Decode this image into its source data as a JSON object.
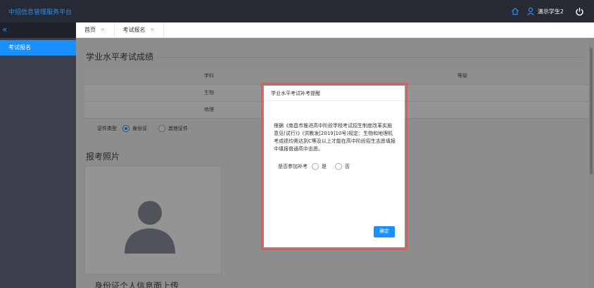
{
  "app": {
    "title": "中招信息管理服务平台",
    "user": "演示学生2"
  },
  "sidebar": {
    "collapse": "«",
    "items": [
      {
        "label": "考试报名"
      }
    ]
  },
  "tabs": [
    {
      "label": "首页",
      "close": "×"
    },
    {
      "label": "考试报名",
      "close": "×"
    }
  ],
  "main": {
    "section_scores": "学业水平考试成绩",
    "table": {
      "headers": [
        "学科",
        "等级"
      ],
      "rows": [
        {
          "subject": "生物",
          "grade": ""
        },
        {
          "subject": "地理",
          "grade": ""
        }
      ]
    },
    "id_type": {
      "label": "证件类型",
      "options": [
        "身份证",
        "其他证件"
      ],
      "selected": "身份证"
    },
    "section_photo": "报考照片",
    "section_id_upload": "身份证个人信息面上传"
  },
  "modal": {
    "title": "学业水平考试补考提醒",
    "body": "根据《南昌市推进高中阶段学校考试招生制度改革实施意见(试行)》(洪教发[2019]10号)规定：生物和地理机考成绩均需达到C等及以上才能在高中阶段招生志愿填报中填报普通高中志愿。",
    "question": "是否参加补考",
    "options": [
      "是",
      "否"
    ],
    "confirm": "确定"
  },
  "colors": {
    "accent": "#1890ff",
    "topbar": "#262a35",
    "sidebar": "#3a3f4b",
    "highlight": "#e8564f"
  }
}
